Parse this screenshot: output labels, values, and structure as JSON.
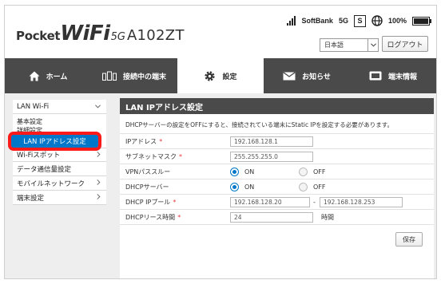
{
  "brand": {
    "pocket": "Pocket",
    "wifi": "WiFi",
    "g5": "5G",
    "model": "A102ZT"
  },
  "status": {
    "carrier": "SoftBank",
    "network": "5G",
    "sim": "S",
    "battery": "100%",
    "battery_level": 1.0
  },
  "header": {
    "language": "日本語",
    "logout": "ログアウト"
  },
  "nav": {
    "home": "ホーム",
    "devices": "接続中の端末",
    "settings": "設定",
    "notices": "お知らせ",
    "device_info": "端末情報"
  },
  "sidebar": {
    "lan_wifi": "LAN Wi-Fi",
    "basic": "基本設定",
    "detail": "詳細設定",
    "lan_ip": "LAN IPアドレス設定",
    "wifi_spot": "Wi-Fiスポット",
    "data_comm": "データ通信量設定",
    "mobile_net": "モバイルネットワーク",
    "device_settings": "端末設定"
  },
  "panel": {
    "title": "LAN IPアドレス設定",
    "description": "DHCPサーバーの設定をOFFにすると、接続されている端末にStatic IPを設定する必要があります。",
    "ip_label": "IPアドレス",
    "ip_value": "192.168.128.1",
    "subnet_label": "サブネットマスク",
    "subnet_value": "255.255.255.0",
    "vpn_label": "VPNパススルー",
    "dhcp_label": "DHCPサーバー",
    "on": "ON",
    "off": "OFF",
    "pool_label": "DHCP IPプール",
    "pool_start": "192.168.128.20",
    "pool_sep": "-",
    "pool_end": "192.168.128.253",
    "lease_label": "DHCPリース時間",
    "lease_value": "24",
    "lease_unit": "時間",
    "required": "*",
    "save": "保存"
  }
}
